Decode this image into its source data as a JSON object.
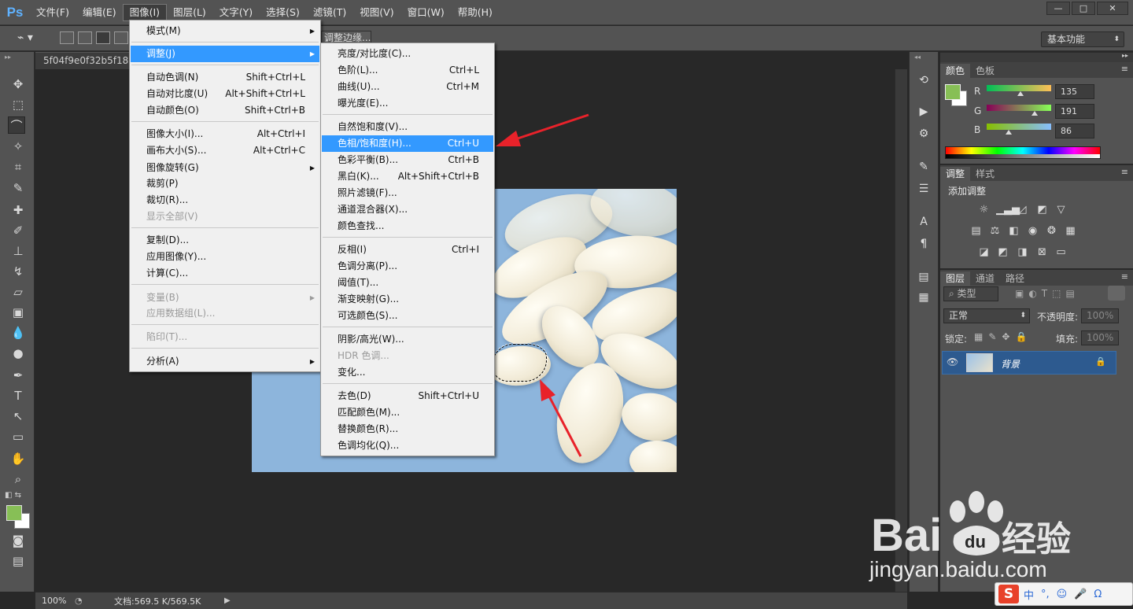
{
  "menubar": {
    "logo": "Ps",
    "items": [
      "文件(F)",
      "编辑(E)",
      "图像(I)",
      "图层(L)",
      "文字(Y)",
      "选择(S)",
      "滤镜(T)",
      "视图(V)",
      "窗口(W)",
      "帮助(H)"
    ],
    "window_buttons": [
      "—",
      "□",
      "✕"
    ]
  },
  "options": {
    "refine_edge": "调整边缘...",
    "workspace": "基本功能"
  },
  "document": {
    "tab_title": "5f04f9e0f32b5f18e",
    "zoom": "100%",
    "doc_size": "文档:569.5 K/569.5K"
  },
  "image_menu": {
    "items": [
      {
        "label": "模式(M)",
        "shortcut": "",
        "submenu": true,
        "disabled": false
      },
      {
        "label": "调整(J)",
        "shortcut": "",
        "submenu": true,
        "disabled": false,
        "highlight": true
      },
      {
        "label": "自动色调(N)",
        "shortcut": "Shift+Ctrl+L",
        "disabled": false
      },
      {
        "label": "自动对比度(U)",
        "shortcut": "Alt+Shift+Ctrl+L",
        "disabled": false
      },
      {
        "label": "自动颜色(O)",
        "shortcut": "Shift+Ctrl+B",
        "disabled": false
      },
      {
        "label": "图像大小(I)...",
        "shortcut": "Alt+Ctrl+I",
        "disabled": false
      },
      {
        "label": "画布大小(S)...",
        "shortcut": "Alt+Ctrl+C",
        "disabled": false
      },
      {
        "label": "图像旋转(G)",
        "shortcut": "",
        "submenu": true,
        "disabled": false
      },
      {
        "label": "裁剪(P)",
        "shortcut": "",
        "disabled": false
      },
      {
        "label": "裁切(R)...",
        "shortcut": "",
        "disabled": false
      },
      {
        "label": "显示全部(V)",
        "shortcut": "",
        "disabled": true
      },
      {
        "label": "复制(D)...",
        "shortcut": "",
        "disabled": false
      },
      {
        "label": "应用图像(Y)...",
        "shortcut": "",
        "disabled": false
      },
      {
        "label": "计算(C)...",
        "shortcut": "",
        "disabled": false
      },
      {
        "label": "变量(B)",
        "shortcut": "",
        "submenu": true,
        "disabled": true
      },
      {
        "label": "应用数据组(L)...",
        "shortcut": "",
        "disabled": true
      },
      {
        "label": "陷印(T)...",
        "shortcut": "",
        "disabled": true
      },
      {
        "label": "分析(A)",
        "shortcut": "",
        "submenu": true,
        "disabled": false
      }
    ]
  },
  "adjust_menu": {
    "items": [
      {
        "label": "亮度/对比度(C)...",
        "shortcut": ""
      },
      {
        "label": "色阶(L)...",
        "shortcut": "Ctrl+L"
      },
      {
        "label": "曲线(U)...",
        "shortcut": "Ctrl+M"
      },
      {
        "label": "曝光度(E)...",
        "shortcut": ""
      },
      {
        "label": "自然饱和度(V)...",
        "shortcut": ""
      },
      {
        "label": "色相/饱和度(H)...",
        "shortcut": "Ctrl+U",
        "highlight": true
      },
      {
        "label": "色彩平衡(B)...",
        "shortcut": "Ctrl+B"
      },
      {
        "label": "黑白(K)...",
        "shortcut": "Alt+Shift+Ctrl+B"
      },
      {
        "label": "照片滤镜(F)...",
        "shortcut": ""
      },
      {
        "label": "通道混合器(X)...",
        "shortcut": ""
      },
      {
        "label": "颜色查找...",
        "shortcut": ""
      },
      {
        "label": "反相(I)",
        "shortcut": "Ctrl+I"
      },
      {
        "label": "色调分离(P)...",
        "shortcut": ""
      },
      {
        "label": "阈值(T)...",
        "shortcut": ""
      },
      {
        "label": "渐变映射(G)...",
        "shortcut": ""
      },
      {
        "label": "可选颜色(S)...",
        "shortcut": ""
      },
      {
        "label": "阴影/高光(W)...",
        "shortcut": ""
      },
      {
        "label": "HDR 色调...",
        "shortcut": "",
        "disabled": true
      },
      {
        "label": "变化...",
        "shortcut": ""
      },
      {
        "label": "去色(D)",
        "shortcut": "Shift+Ctrl+U"
      },
      {
        "label": "匹配颜色(M)...",
        "shortcut": ""
      },
      {
        "label": "替换颜色(R)...",
        "shortcut": ""
      },
      {
        "label": "色调均化(Q)...",
        "shortcut": ""
      }
    ]
  },
  "color_panel": {
    "tabs": [
      "颜色",
      "色板"
    ],
    "r_label": "R",
    "g_label": "G",
    "b_label": "B",
    "r": "135",
    "g": "191",
    "b": "86",
    "fg_color": "#87bf56"
  },
  "adjust_panel": {
    "tabs": [
      "调整",
      "样式"
    ],
    "title": "添加调整"
  },
  "layers_panel": {
    "tabs": [
      "图层",
      "通道",
      "路径"
    ],
    "filter": "类型",
    "blend_mode": "正常",
    "opacity_label": "不透明度:",
    "opacity": "100%",
    "lock_label": "锁定:",
    "fill_label": "填充:",
    "fill": "100%",
    "layer_name": "背景"
  },
  "watermark": {
    "text": "jingyan.baidu.com"
  },
  "ime": {
    "items": [
      "中",
      "°,",
      "☺",
      "🎤",
      "Ω"
    ]
  }
}
